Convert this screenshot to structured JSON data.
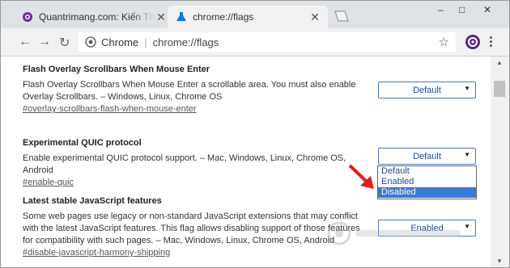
{
  "tabs": [
    {
      "title": "Quantrimang.com: Kiến Thức Cô",
      "icon": "quantrimang-favicon"
    },
    {
      "title": "chrome://flags",
      "icon": "flask-icon"
    }
  ],
  "window": {
    "minimize": "–",
    "maximize": "□",
    "close": "✕"
  },
  "toolbar": {
    "back": "←",
    "forward": "→",
    "reload": "↻",
    "site": "Chrome",
    "separator": "|",
    "url": "chrome://flags",
    "star": "☆"
  },
  "flags": [
    {
      "name": "Flash Overlay Scrollbars When Mouse Enter",
      "description": "Flash Overlay Scrollbars When Mouse Enter a scrollable area. You must also enable Overlay Scrollbars. – Windows, Linux, Chrome OS",
      "link": "#overlay-scrollbars-flash-when-mouse-enter",
      "select_value": "Default"
    },
    {
      "name": "Experimental QUIC protocol",
      "description": "Enable experimental QUIC protocol support. – Mac, Windows, Linux, Chrome OS, Android",
      "link": "#enable-quic",
      "select_value": "Default"
    },
    {
      "name": "Latest stable JavaScript features",
      "description": "Some web pages use legacy or non-standard JavaScript extensions that may conflict with the latest JavaScript features. This flag allows disabling support of those features for compatibility with such pages. – Mac, Windows, Linux, Chrome OS, Android",
      "link": "#disable-javascript-harmony-shipping",
      "select_value": "Enabled"
    }
  ],
  "dropdown": {
    "options": [
      "Default",
      "Enabled",
      "Disabled"
    ],
    "highlighted": "Disabled"
  },
  "colors": {
    "accent": "#3a7bd5",
    "arrow": "#e02020"
  }
}
